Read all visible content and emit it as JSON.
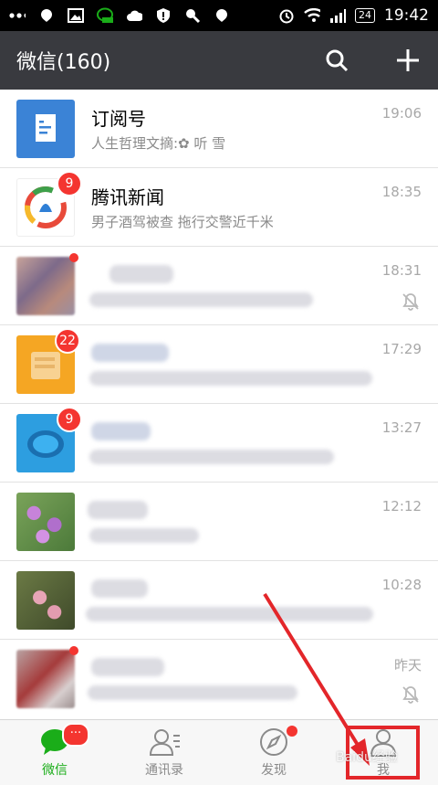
{
  "status_bar": {
    "time": "19:42",
    "battery": "24",
    "icons": [
      "more-dots-icon",
      "notification-icon",
      "gallery-icon",
      "wechat-icon",
      "cloud-icon",
      "shield-icon",
      "tool-icon",
      "notification-icon",
      "alarm-icon",
      "wifi-icon",
      "signal-icon",
      "battery-icon"
    ]
  },
  "header": {
    "title": "微信(160)",
    "actions": [
      "search-icon",
      "plus-icon"
    ],
    "bg_color": "#393a3f"
  },
  "chats": [
    {
      "name": "订阅号",
      "preview": "人生哲理文摘:✿ 听 雪",
      "time": "19:06",
      "avatar_color": "#3b83d6"
    },
    {
      "name": "腾讯新闻",
      "preview": "男子酒驾被查 拖行交警近千米",
      "time": "18:35",
      "badge": "9",
      "avatar_color": "#ffffff"
    },
    {
      "name": "",
      "preview": "",
      "time": "18:31",
      "muted": true,
      "dot": true
    },
    {
      "name": "",
      "preview": "",
      "time": "17:29",
      "badge": "22"
    },
    {
      "name": "",
      "preview": "",
      "time": "13:27",
      "badge": "9"
    },
    {
      "name": "",
      "preview": "",
      "time": "12:12"
    },
    {
      "name": "",
      "preview": "",
      "time": "10:28"
    },
    {
      "name": "",
      "preview": "",
      "time": "昨天",
      "muted": true,
      "dot": true
    }
  ],
  "tabs": [
    {
      "label": "微信",
      "icon": "chat-bubble-icon",
      "active": true,
      "badge": "···"
    },
    {
      "label": "通讯录",
      "icon": "contacts-icon"
    },
    {
      "label": "发现",
      "icon": "compass-icon",
      "dot": true
    },
    {
      "label": "我",
      "icon": "person-icon"
    }
  ],
  "watermark": "Baidu经验",
  "colors": {
    "accent": "#1aad19",
    "badge": "#f43530",
    "annotation": "#e3262a"
  }
}
